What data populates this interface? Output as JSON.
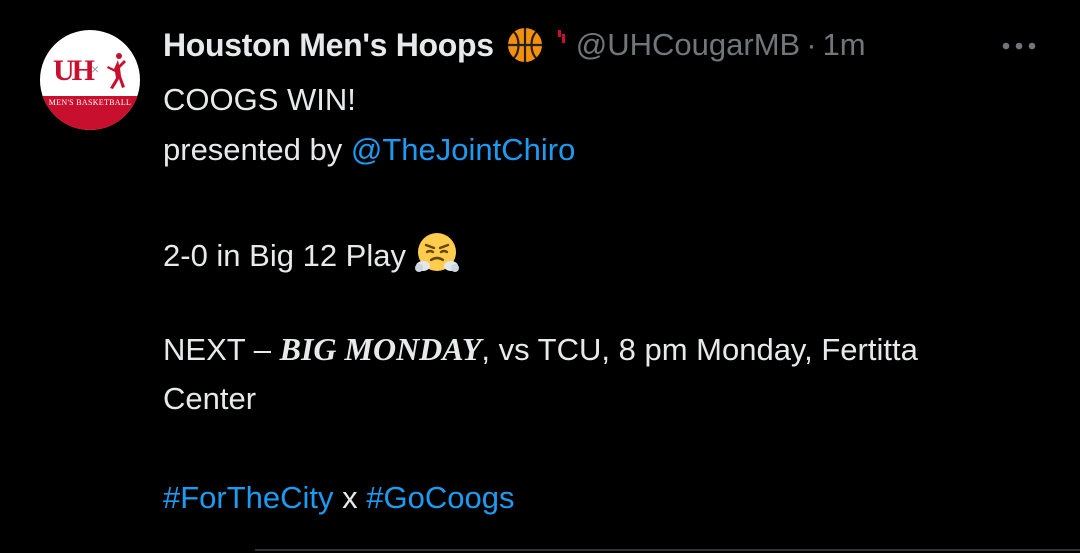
{
  "tweet": {
    "display_name": "Houston Men's Hoops",
    "handle": "@UHCougarMB",
    "separator": "·",
    "time": "1m",
    "avatar": {
      "monogram": "UH",
      "cross": "×",
      "band_text": "MEN'S BASKETBALL",
      "brand_color": "#c8102e"
    },
    "name_emoji": "basketball-icon",
    "more_icon": "more-horizontal-icon",
    "lines": {
      "line1": "COOGS WIN!",
      "line2_prefix": "presented by ",
      "line2_mention": "@TheJointChiro",
      "line3": "2-0 in Big 12 Play",
      "line3_emoji": "face-with-steam-from-nose-emoji",
      "line4_prefix": "NEXT – ",
      "line4_styled": "BIG MONDAY",
      "line4_suffix": ", vs TCU, 8 pm Monday, Fertitta",
      "line5": "Center",
      "hashtag1": "#ForTheCity",
      "hashtag_join": " x ",
      "hashtag2": "#GoCoogs"
    },
    "colors": {
      "background": "#000000",
      "text": "#e7e9ea",
      "secondary": "#71767b",
      "link": "#1d9bf0"
    }
  }
}
